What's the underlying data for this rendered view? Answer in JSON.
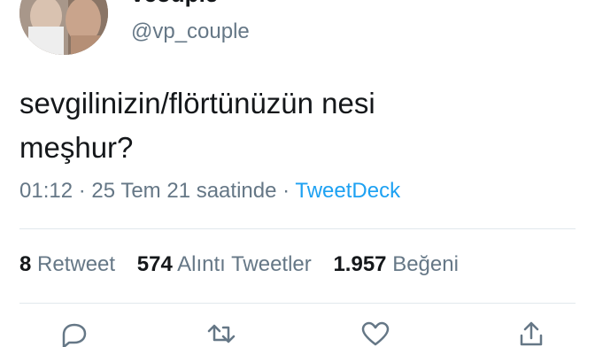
{
  "tweet": {
    "display_name": "vcouple",
    "handle": "@vp_couple",
    "text_line1": "sevgilinizin/flörtünüzün nesi",
    "text_line2": "meşhur?",
    "time": "01:12",
    "separator1": "·",
    "date": "25 Tem 21 saatinde",
    "separator2": "·",
    "source": "TweetDeck"
  },
  "stats": {
    "retweets_count": "8",
    "retweets_label": "Retweet",
    "quotes_count": "574",
    "quotes_label": "Alıntı Tweetler",
    "likes_count": "1.957",
    "likes_label": "Beğeni"
  },
  "icons": {
    "menu": "chevron-down-icon",
    "reply": "reply-icon",
    "retweet": "retweet-icon",
    "like": "heart-icon",
    "share": "share-icon"
  },
  "colors": {
    "link": "#1da1f2",
    "secondary": "#657786",
    "primary": "#14171a",
    "divider": "#e1e8ed"
  }
}
